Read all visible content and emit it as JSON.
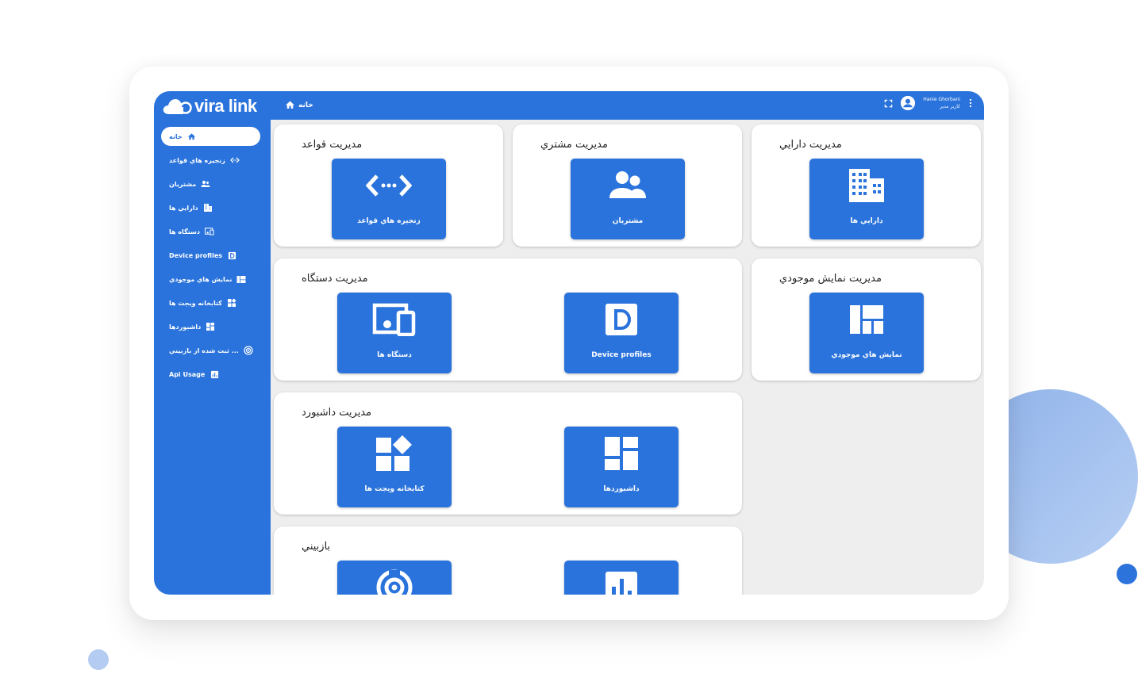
{
  "brand": {
    "name": "vira link"
  },
  "breadcrumb": {
    "home": "خانه"
  },
  "user": {
    "name": "Hanie Ghorbani",
    "role": "کاربر مدیر"
  },
  "sidebar": {
    "items": [
      {
        "label": "خانه",
        "icon": "home-icon"
      },
      {
        "label": "زنجیره هاي قواعد",
        "icon": "code-icon"
      },
      {
        "label": "مشتريان",
        "icon": "people-icon"
      },
      {
        "label": "دارايي ها",
        "icon": "building-icon"
      },
      {
        "label": "دستگاه ها",
        "icon": "devices-icon"
      },
      {
        "label": "Device profiles",
        "icon": "device-profile-icon"
      },
      {
        "label": "نمايش هاي موجودي",
        "icon": "table-icon"
      },
      {
        "label": "كتابخانه ويجت ها",
        "icon": "widgets-icon"
      },
      {
        "label": "داشبوردها",
        "icon": "dashboard-icon"
      },
      {
        "label": "... ثبت شده از بازبيني",
        "icon": "audit-icon"
      },
      {
        "label": "Api Usage",
        "icon": "usage-icon"
      }
    ]
  },
  "cards": {
    "rules": {
      "title": "مديريت قواعد",
      "tiles": [
        "زنجيره هاي قواعد"
      ]
    },
    "customers": {
      "title": "مديريت مشتري",
      "tiles": [
        "مشتريان"
      ]
    },
    "assets": {
      "title": "مديريت دارايي",
      "tiles": [
        "دارايي ها"
      ]
    },
    "devices": {
      "title": "مديريت دستگاه",
      "tiles": [
        "دستگاه ها",
        "Device profiles"
      ]
    },
    "entity_views": {
      "title": "مديريت نمايش موجودي",
      "tiles": [
        "نمايش هاي موجودي"
      ]
    },
    "dashboards": {
      "title": "مديريت داشبورد",
      "tiles": [
        "كتابخانه ويجت ها",
        "داشبوردها"
      ]
    },
    "audit": {
      "title": "بازبيني"
    }
  },
  "colors": {
    "primary": "#2a73dc",
    "background": "#eeeeee"
  }
}
